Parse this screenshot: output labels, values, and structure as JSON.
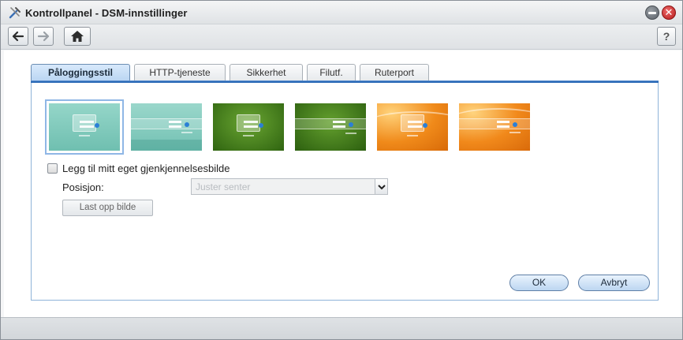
{
  "window": {
    "title": "Kontrollpanel - DSM-innstillinger",
    "icons": {
      "app": "tools-icon",
      "minimize": "minimize-icon",
      "close": "close-icon"
    },
    "close_glyph": "✕"
  },
  "toolbar": {
    "back_icon": "arrow-left-icon",
    "forward_icon": "arrow-right-icon",
    "home_icon": "home-icon",
    "help_label": "?"
  },
  "tabs": [
    {
      "label": "Påloggingsstil",
      "active": true
    },
    {
      "label": "HTTP-tjeneste",
      "active": false
    },
    {
      "label": "Sikkerhet",
      "active": false
    },
    {
      "label": "Filutf.",
      "active": false
    },
    {
      "label": "Ruterport",
      "active": false
    }
  ],
  "login_styles": [
    {
      "name": "teal-box",
      "selected": true
    },
    {
      "name": "teal-bar",
      "selected": false
    },
    {
      "name": "green-box",
      "selected": false
    },
    {
      "name": "green-bar",
      "selected": false
    },
    {
      "name": "orange-box",
      "selected": false
    },
    {
      "name": "orange-bar",
      "selected": false
    }
  ],
  "custom_image": {
    "checkbox_label": "Legg til mitt eget gjenkjennelsesbilde",
    "checked": false,
    "position_label": "Posisjon:",
    "position_value": "Juster senter",
    "upload_label": "Last opp bilde"
  },
  "actions": {
    "ok_label": "OK",
    "cancel_label": "Avbryt"
  },
  "colors": {
    "accent": "#2b6ab7",
    "teal": "#8ecfc3",
    "green": "#4e8a1e",
    "orange": "#f08a1a"
  }
}
